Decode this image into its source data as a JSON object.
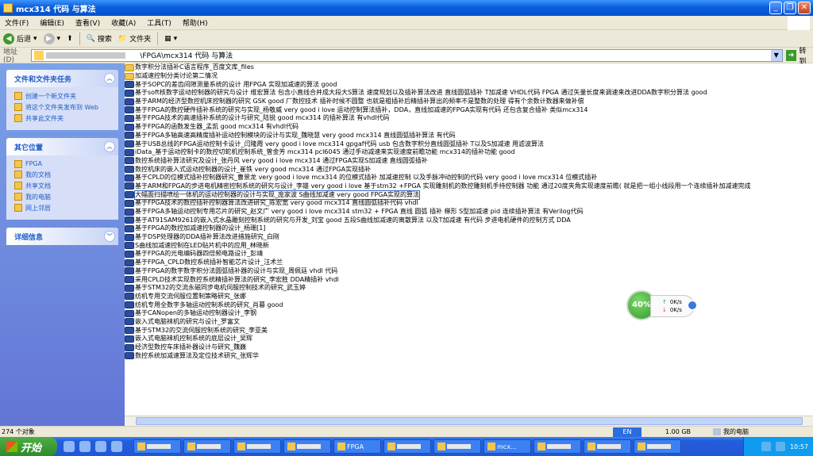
{
  "window": {
    "title": "mcx314 代码 与算法"
  },
  "menu": [
    "文件(F)",
    "编辑(E)",
    "查看(V)",
    "收藏(A)",
    "工具(T)",
    "帮助(H)"
  ],
  "toolbar": {
    "back": "后退",
    "search": "搜索",
    "folders": "文件夹"
  },
  "address": {
    "label": "地址(D)",
    "value": "\\FPGA\\mcx314 代码 与算法",
    "go": "转到"
  },
  "left_pane": {
    "tasks": {
      "title": "文件和文件夹任务",
      "items": [
        "创建一个新文件夹",
        "将这个文件夹发布到 Web",
        "共享此文件夹"
      ]
    },
    "other": {
      "title": "其它位置",
      "items": [
        "FPGA",
        "我的文档",
        "共享文档",
        "我的电脑",
        "网上邻居"
      ]
    },
    "details": {
      "title": "详细信息"
    }
  },
  "files": [
    {
      "name": "数字积分法插补C语言程序_百度文库_files",
      "type": "folder"
    },
    {
      "name": "加减速控制分类讨论第二情况",
      "type": "folder"
    },
    {
      "name": "基于SOPC的差齿间隙测量系统的设计  用FPGA 实现加减速的算法 good",
      "type": "file"
    },
    {
      "name": "基于soft核数字运动控制器的研究与设计 维宏算法 包含小直线合并成大段大S算法  速度规划以及插补算法改进  直线圆弧插补 T加减速 VHDL代码 FPGA 通过矢量长度来调速来改进DDA数字积分算法 good",
      "type": "file"
    },
    {
      "name": "基于ARM的经济型数控机床控制器的研究  GSK  good  厂数控技术   插补时候不圆整 也就是粗插补后精插补算出的频率不是整数的处理  得有个余数计数器来做补偿",
      "type": "file"
    },
    {
      "name": "基于FPGA的数控硬件插补系统的研究与实现_杨敬威  very good i love 运动控制算法插补，DDA，直线加减速的FPGA实现有代码 还包含复合插补 类似mcx314",
      "type": "file"
    },
    {
      "name": "基于FPGA技术的高速插补系统的设计与研究_陆锐 good mcx314 的插补算法  有vhdl代码",
      "type": "file"
    },
    {
      "name": "基于FPGA的函数发生器_孟凯 good mcx314 有vhdl代码",
      "type": "file"
    },
    {
      "name": "基于FPGA多轴高速高精度插补运动控制模块的设计与实现_魏晓慧 very good mcx314 直线圆弧插补算法 有代码",
      "type": "file"
    },
    {
      "name": "基于USB总线的FPGA运动控制卡设计_闫隆霞 very good i love mcx314 gpgaf代码 usb  包含数字积分直线圆弧插补  T以及S加减速 用滤波算法",
      "type": "file"
    },
    {
      "name": "iData_基于运动控制卡的数控切蛇机控制系统_曾金芳   mcx314  pcl6045  通过手动减速来实现速度前瞻功能  mcx314的插补功能 good",
      "type": "file"
    },
    {
      "name": "数控系统插补算法研究及设计_张丹风 very good i love mcx314 通过FPGA实现S加减速  直线圆弧插补",
      "type": "file"
    },
    {
      "name": "数控机床的嵌入式运动控制器的设计_崔铁 very good mcx314 通过FPGA实现插补",
      "type": "file"
    },
    {
      "name": "基于CPLD的位模式插补控制器研究_曹景龙 very good i love mcx314 的位模式插补 加减速控制 以及手脉冲动控制的代码 very good i love mcx314  位模式插补",
      "type": "file"
    },
    {
      "name": "基于ARM和FPGA的步进电机精密控制系统的研究与设计_李雄  very good i love 基于stm32 +FPGA 实现雕刻机的数控雕刻机手持控制器 功能 通过20度夹角实现速度前瞻( 就是把一组小线段用一个连续插补加减速完成",
      "type": "file"
    },
    {
      "name": "大幅面扫描喷绘一体机的运动控制器的设计与实现_庞家波  S曲线加减速 very good FPGA实现的算法",
      "type": "file",
      "selected": true
    },
    {
      "name": "基于FPGA技术的数控插补控制器算法改进研究_陈宏宽 very good mcx314 直线圆弧插补代码  vhdl",
      "type": "file"
    },
    {
      "name": "基于FPGA多轴运动控制专用芯片的研究_赵文广 very good  i love mcx314 stm32 + FPGA 直线 圆弧 插补 梯形 S型加减速 pid  连续插补算法 有Verilog代码",
      "type": "file"
    },
    {
      "name": "基于AT91SAM9261的嵌入式水晶雕刻控制系统的研究与开发_刘宝   good 五段S曲线加减速的离散算法   以及T加减速   有代码 步进电机硬件的控制方式 DDA",
      "type": "file"
    },
    {
      "name": "基于FPGA的数控加减速控制器的设计_杨珊[1]",
      "type": "file"
    },
    {
      "name": "基于DSP处理器的DDA插补算法改进措施研究_白刚",
      "type": "file"
    },
    {
      "name": "S曲线加减速控制在LED贴片机中的应用_林晓新",
      "type": "file"
    },
    {
      "name": "基于FPGA的光电编码器四倍频电路设计_彭靖",
      "type": "file"
    },
    {
      "name": "基于FPGA_CPLD数控系统插补智能芯片设计_汪术兰",
      "type": "file"
    },
    {
      "name": "基于FPGA的数字数字积分法圆弧插补器的设计与实现_周佩廷 vhdl 代码",
      "type": "file"
    },
    {
      "name": "采用CPLD技术实现数控系统精插补算法的研究_李宏胜 DDA精插补 vhdl",
      "type": "file"
    },
    {
      "name": "基于STM32的交流永磁同步电机伺服控制技术的研究_武玉婷",
      "type": "file"
    },
    {
      "name": "纺机专用交流伺服位置制策略研究_张娜",
      "type": "file"
    },
    {
      "name": "纺机专用全数字多轴运动控制系统的研究_肖暮 good",
      "type": "file"
    },
    {
      "name": "基于CANopen的多轴运动控制器设计_李钢",
      "type": "file"
    },
    {
      "name": "嵌入式电脑袜机的研究与设计_罗富文",
      "type": "file"
    },
    {
      "name": "基于STM32的交流伺服控制系统的研究_李亚美",
      "type": "file"
    },
    {
      "name": "嵌入式电脑袜机控制系统的底层设计_吴辉",
      "type": "file"
    },
    {
      "name": "经济型数控车床插补器设计与研究_魏巍",
      "type": "file"
    },
    {
      "name": "数控系统加减速算法及定位技术研究_张辉华",
      "type": "file"
    }
  ],
  "status": {
    "count": "274 个对象",
    "ime": "EN",
    "size": "1.00 GB",
    "location": "我的电脑"
  },
  "net_widget": {
    "percent": "40%",
    "up": "0K/s",
    "down": "0K/s"
  },
  "taskbar": {
    "start": "开始",
    "items": [
      "",
      "",
      "",
      "",
      "FPGA",
      "",
      "",
      "mcx...",
      "",
      "",
      ""
    ],
    "clock": "10:57"
  }
}
